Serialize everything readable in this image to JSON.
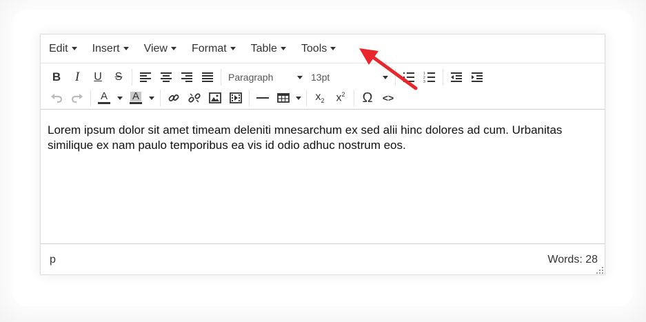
{
  "menubar": {
    "items": [
      {
        "label": "Edit"
      },
      {
        "label": "Insert"
      },
      {
        "label": "View"
      },
      {
        "label": "Format"
      },
      {
        "label": "Table"
      },
      {
        "label": "Tools"
      }
    ]
  },
  "toolbar": {
    "bold": "B",
    "italic": "I",
    "underline": "U",
    "strike": "S",
    "block_format": "Paragraph",
    "font_size": "13pt",
    "text_color": "A",
    "bg_color": "A",
    "subscript": "x",
    "subscript_sub": "2",
    "superscript": "x",
    "superscript_sup": "2",
    "special_char": "Ω",
    "code": "<>"
  },
  "content": {
    "text": "Lorem ipsum dolor sit amet timeam deleniti mnesarchum ex sed alii hinc dolores ad cum. Urbanitas similique ex nam paulo temporibus ea vis id odio adhuc nostrum eos."
  },
  "statusbar": {
    "path": "p",
    "word_count": "Words: 28"
  },
  "colors": {
    "arrow": "#e8262b",
    "text_color_bar": "#333333",
    "bg_color_bar": "#c8c8c8"
  }
}
